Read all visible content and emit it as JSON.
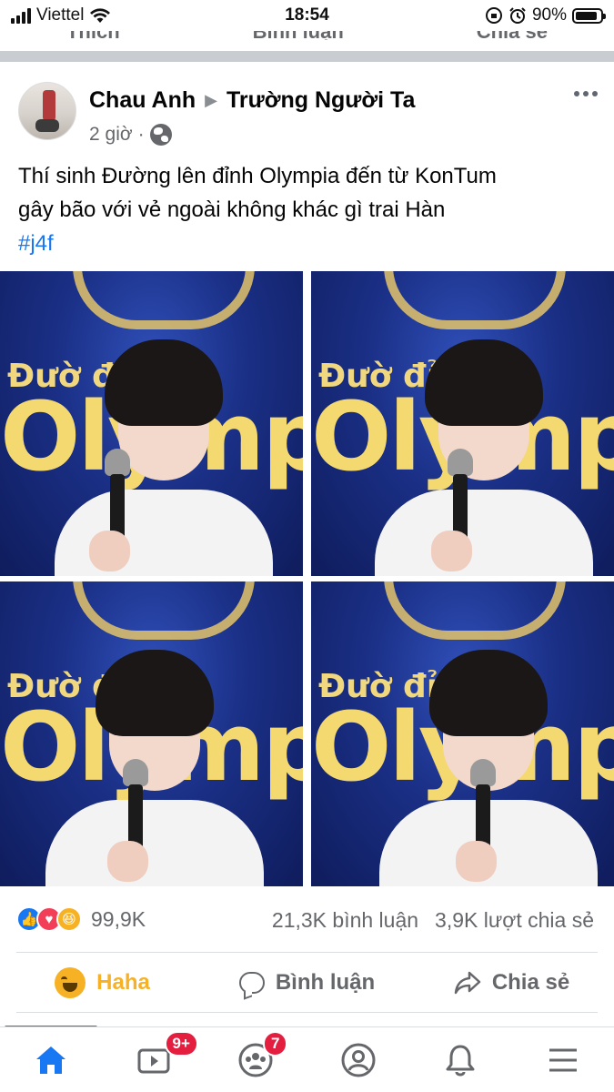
{
  "status_bar": {
    "carrier": "Viettel",
    "time": "18:54",
    "battery_percent": "90%",
    "battery_level": 0.9
  },
  "previous_post_actions": [
    "Thích",
    "Bình luận",
    "Chia sẻ"
  ],
  "post": {
    "author": "Chau Anh",
    "group": "Trường Người Ta",
    "time_ago": "2 giờ",
    "separator": "·",
    "text_line_1": "Thí sinh Đường lên đỉnh Olympia đến từ KonTum",
    "text_line_2": "gây bão với vẻ ngoài không khác gì trai Hàn",
    "hashtag": "#j4f",
    "photos": [
      {
        "title_a": "Đườ      đỉnh",
        "title_b": "Olympia"
      },
      {
        "title_a": "Đườ      đỉnh",
        "title_b": "Olympia"
      },
      {
        "title_a": "Đườ      đỉnh",
        "title_b": "Olympia"
      },
      {
        "title_a": "Đườ      đỉnh",
        "title_b": "Olympia"
      }
    ],
    "reaction_icons": [
      "like-icon",
      "love-icon",
      "haha-icon"
    ],
    "reaction_count": "99,9K",
    "comment_count": "21,3K bình luận",
    "share_count": "3,9K lượt chia sẻ"
  },
  "actions": {
    "reaction_label": "Haha",
    "comment_label": "Bình luận",
    "share_label": "Chia sẻ"
  },
  "tabbar": {
    "items": [
      "home-icon",
      "watch-icon",
      "groups-icon",
      "profile-icon",
      "notifications-icon",
      "menu-icon"
    ],
    "watch_badge": "9+",
    "groups_badge": "7"
  },
  "colors": {
    "accent": "#1877f2",
    "haha": "#f7b125",
    "badge": "#e41e3f",
    "secondary_text": "#65676b"
  }
}
